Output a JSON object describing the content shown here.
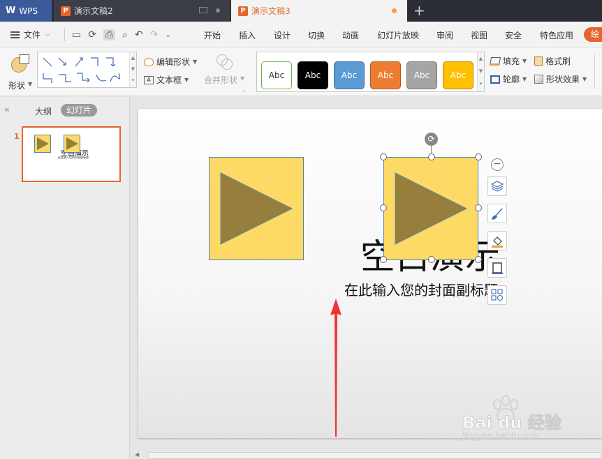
{
  "titlebar": {
    "app_label": "WPS",
    "tabs": [
      {
        "label": "演示文稿2"
      },
      {
        "label": "演示文稿3"
      }
    ],
    "new_tab": "+"
  },
  "menu": {
    "file": "文件",
    "items": [
      "开始",
      "插入",
      "设计",
      "切换",
      "动画",
      "幻灯片放映",
      "审阅",
      "视图",
      "安全",
      "特色应用"
    ],
    "active_partial": "绘"
  },
  "ribbon": {
    "shape_label": "形状",
    "edit_shape": "编辑形状",
    "text_box": "文本框",
    "merge_shape": "合并形状",
    "style_samples": [
      {
        "label": "Abc",
        "bg": "#ffffff",
        "fg": "#333333",
        "border": "#70ad47"
      },
      {
        "label": "Abc",
        "bg": "#000000",
        "fg": "#ffffff",
        "border": "#000000"
      },
      {
        "label": "Abc",
        "bg": "#5b9bd5",
        "fg": "#ffffff",
        "border": "#41719c"
      },
      {
        "label": "Abc",
        "bg": "#ed7d31",
        "fg": "#ffffff",
        "border": "#ae5a21"
      },
      {
        "label": "Abc",
        "bg": "#a5a5a5",
        "fg": "#ffffff",
        "border": "#787878"
      },
      {
        "label": "Abc",
        "bg": "#ffc000",
        "fg": "#ffffff",
        "border": "#bc8c00"
      }
    ],
    "fill": "填充",
    "outline": "轮廓",
    "format_painter": "格式刷",
    "shape_effect": "形状效果"
  },
  "sidebar": {
    "tab_outline": "大纲",
    "tab_slides": "幻灯片",
    "slide_number": "1",
    "thumb_title": "空白演示",
    "thumb_subtitle": "在此输入您的封面副标题"
  },
  "slide": {
    "title": "空白演示",
    "subtitle": "在此输入您的封面副标题"
  },
  "watermark": {
    "brand": "Bai du 经验",
    "url": "jingyan.baidu.com"
  },
  "colors": {
    "accent": "#e8642c",
    "shape_fill": "#fdd966",
    "triangle_fill": "#967f3c",
    "arrow": "#ee3333"
  }
}
